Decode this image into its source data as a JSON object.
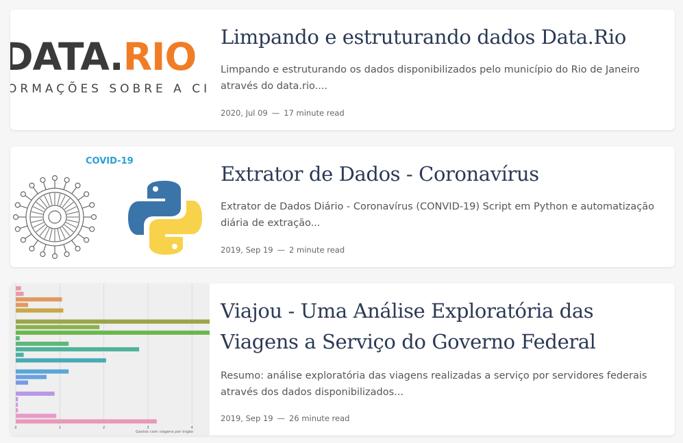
{
  "posts": [
    {
      "title": "Limpando e estruturando dados Data.Rio",
      "excerpt": "Limpando e estruturando os dados disponibilizados pelo município do Rio de Janeiro através do data.rio....",
      "date": "2020, Jul 09",
      "separator": "—",
      "read_time": "17 minute read",
      "thumb": {
        "logo_left": "DATA.",
        "logo_right": "RIO",
        "tagline": "ORMAÇÕES SOBRE A CIDADE"
      }
    },
    {
      "title": "Extrator de Dados - Coronavírus",
      "excerpt": "Extrator de Dados Diário - Coronavírus (CONVID-19) Script em Python e automatização diária de extração...",
      "date": "2019, Sep 19",
      "separator": "—",
      "read_time": "2 minute read",
      "thumb": {
        "label": "COVID-19",
        "virus_icon": "virus-icon",
        "python_icon": "python-logo-icon"
      }
    },
    {
      "title": "Viajou - Uma Análise Exploratória das Viagens a Serviço do Governo Federal",
      "excerpt": "Resumo: análise exploratória das viagens realizadas a serviço por servidores federais através dos dados disponibilizados...",
      "date": "2019, Sep 19",
      "separator": "—",
      "read_time": "26 minute read",
      "thumb": {
        "xlabel": "Gastos com viagens por órgão"
      }
    }
  ],
  "colors": {
    "title": "#2b3a55",
    "brand_orange": "#f07d26",
    "covid_blue": "#2a9fd6"
  },
  "chart_data": {
    "type": "bar",
    "orientation": "horizontal",
    "xlabel": "Gastos com viagens por órgão",
    "x_ticks": [
      "0",
      "1",
      "2",
      "3",
      "4"
    ],
    "series": [
      {
        "values": [
          0.12,
          0.18,
          1.05,
          0.28,
          1.08,
          0,
          4.4,
          1.9,
          4.4,
          0.09,
          1.2,
          2.8,
          0.18,
          2.05,
          0,
          1.2,
          0.7,
          0.28,
          0,
          0.88,
          0.05,
          0.05,
          0.05,
          0.92,
          3.2
        ],
        "colors": [
          "#e89aa8",
          "#e89aa8",
          "#e09a60",
          "#e09a60",
          "#c9a84a",
          "#c9a84a",
          "#9aa54a",
          "#8eb150",
          "#6cb650",
          "#5fb87a",
          "#5fb87a",
          "#4fb29a",
          "#4fb0a8",
          "#4aaab3",
          "#4aaab3",
          "#5aa6d6",
          "#6aa0e0",
          "#7a98e8",
          "#9a90e8",
          "#b898e8",
          "#c79ae0",
          "#d79ad8",
          "#e09ad0",
          "#e69ac8",
          "#e898b8"
        ]
      }
    ]
  }
}
